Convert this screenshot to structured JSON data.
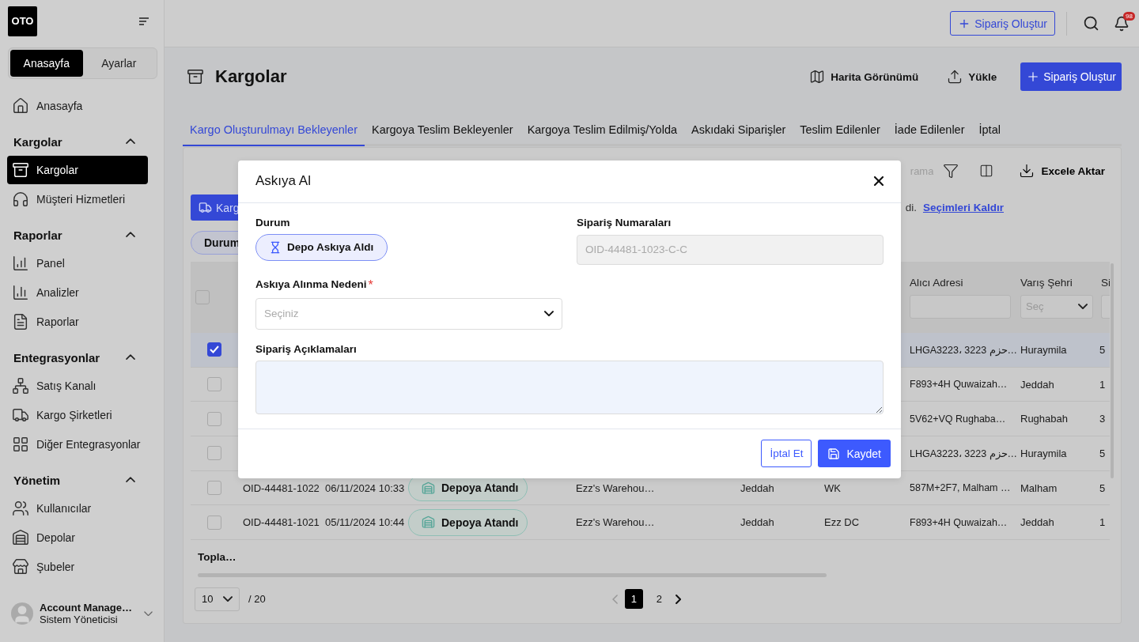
{
  "sidebar": {
    "logo": "OTO",
    "mode_tabs": [
      {
        "label": "Anasayfa",
        "selected": true
      },
      {
        "label": "Ayarlar",
        "selected": false
      }
    ],
    "home_item": {
      "label": "Anasayfa",
      "selected": false
    },
    "sections": [
      {
        "title": "Kargolar",
        "expanded": true,
        "items": [
          {
            "label": "Kargolar",
            "selected": true
          },
          {
            "label": "Müşteri Hizmetleri",
            "selected": false
          }
        ]
      },
      {
        "title": "Raporlar",
        "expanded": true,
        "items": [
          {
            "label": "Panel",
            "selected": false
          },
          {
            "label": "Analizler",
            "selected": false
          },
          {
            "label": "Raporlar",
            "selected": false
          }
        ]
      },
      {
        "title": "Entegrasyonlar",
        "expanded": true,
        "items": [
          {
            "label": "Satış Kanalı",
            "selected": false
          },
          {
            "label": "Kargo Şirketleri",
            "selected": false
          },
          {
            "label": "Diğer Entegrasyonlar",
            "selected": false
          }
        ]
      },
      {
        "title": "Yönetim",
        "expanded": true,
        "items": [
          {
            "label": "Kullanıcılar",
            "selected": false
          },
          {
            "label": "Depolar",
            "selected": false
          },
          {
            "label": "Şubeler",
            "selected": false
          }
        ]
      }
    ],
    "account": {
      "name": "Account Manage…",
      "role": "Sistem Yöneticisi"
    }
  },
  "topbar": {
    "create_button": "Sipariş Oluştur",
    "notification_count": "98"
  },
  "page": {
    "title": "Kargolar",
    "actions": [
      {
        "kind": "link",
        "label": "Harita Görünümü"
      },
      {
        "kind": "link",
        "label": "Yükle"
      },
      {
        "kind": "primary",
        "label": "Sipariş Oluştur"
      }
    ]
  },
  "tabs": [
    {
      "label": "Kargo Oluşturulmayı Bekleyenler",
      "selected": true
    },
    {
      "label": "Kargoya Teslim Bekleyenler",
      "selected": false
    },
    {
      "label": "Kargoya Teslim Edilmiş/Yolda",
      "selected": false
    },
    {
      "label": "Askıdaki Siparişler",
      "selected": false
    },
    {
      "label": "Teslim Edilenler",
      "selected": false
    },
    {
      "label": "İade Edilenler",
      "selected": false
    },
    {
      "label": "İptal",
      "selected": false
    }
  ],
  "card": {
    "search": {
      "placeholder": "rama"
    },
    "export_button": "Excele Aktar",
    "bulk_button": "Karg",
    "selection_text": "di.",
    "clear_link": "Seçimleri Kaldır",
    "filter_chip": "Durum"
  },
  "table": {
    "header_checked": false,
    "columns": [
      {
        "label": "Alıcı Adresi",
        "kind": "input"
      },
      {
        "label": "Varış Şehri",
        "kind": "select",
        "placeholder": "Seç"
      },
      {
        "label": "Si",
        "kind": "input"
      }
    ],
    "rows": [
      {
        "selected": true,
        "address": "LHGA3223، 3223 حزم…",
        "city": "Huraymila",
        "si": "5"
      },
      {
        "selected": false,
        "address": "F893+4H Quwaizah…",
        "city": "Jeddah",
        "si": "1"
      },
      {
        "selected": false,
        "address": "5V62+VQ Rughaba…",
        "city": "Rughabah",
        "si": "3"
      },
      {
        "selected": false,
        "address": "LHGA3223، 3223 حزم…",
        "city": "Huraymila",
        "si": "5"
      },
      {
        "selected": false,
        "id": "OID-44481-1022",
        "date": "06/11/2024 10:33",
        "status": "Depoya Atandı",
        "warehouse": "Ezz's Warehou…",
        "origin": "Jeddah",
        "depot": "WK",
        "address": "587M+2F7, Malham …",
        "city": "Malham",
        "si": "5"
      },
      {
        "selected": false,
        "id": "OID-44481-1021",
        "date": "05/11/2024 10:44",
        "status": "Depoya Atandı",
        "warehouse": "Ezz's Warehou…",
        "origin": "Jeddah",
        "depot": "Ezz DC",
        "address": "F893+4H Quwaizah…",
        "city": "Jeddah",
        "si": "1"
      }
    ],
    "footer": "Topla…"
  },
  "pagination": {
    "page_size": "10",
    "total": "/ 20",
    "pages": [
      {
        "label": "1",
        "selected": true
      },
      {
        "label": "2",
        "selected": false
      }
    ]
  },
  "modal": {
    "title": "Askıya Al",
    "status_label": "Durum",
    "status_chip": "Depo Askıya Aldı",
    "order_numbers_label": "Sipariş Numaraları",
    "order_numbers_value": "OID-44481-1023-C-C",
    "reason_label": "Askıya Alınma Nedeni",
    "required_mark": "*",
    "reason_placeholder": "Seçiniz",
    "notes_label": "Sipariş Açıklamaları",
    "cancel_button": "İptal Et",
    "save_button": "Kaydet"
  }
}
